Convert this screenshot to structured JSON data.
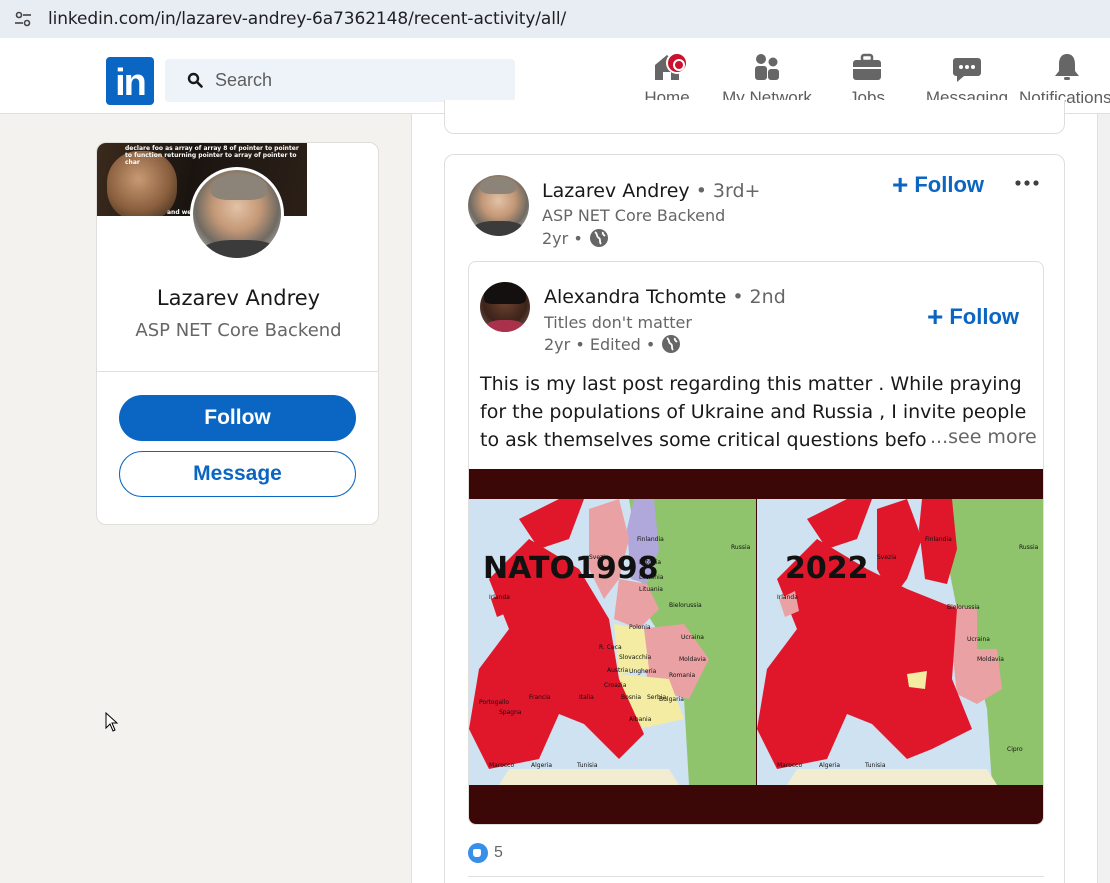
{
  "browser": {
    "url": "linkedin.com/in/lazarev-andrey-6a7362148/recent-activity/all/"
  },
  "header": {
    "logo_text": "in",
    "search_placeholder": "Search",
    "nav": [
      {
        "label": "Home",
        "icon": "home-icon",
        "notification_badge": true
      },
      {
        "label": "My Network",
        "icon": "people-icon"
      },
      {
        "label": "Jobs",
        "icon": "briefcase-icon"
      },
      {
        "label": "Messaging",
        "icon": "chat-icon"
      },
      {
        "label": "Notifications",
        "icon": "bell-icon"
      }
    ]
  },
  "profile_card": {
    "name": "Lazarev Andrey",
    "headline": "ASP NET Core Backend",
    "cover_meme_text": "declare foo as array of array 8 of pointer to pointer to function returning pointer to array of pointer to char",
    "cover_meme_text_2": "and we p",
    "follow_label": "Follow",
    "message_label": "Message"
  },
  "post": {
    "author": "Lazarev Andrey",
    "degree": "• 3rd+",
    "headline": "ASP NET Core Backend",
    "time": "2yr •",
    "follow_label": "Follow",
    "shared": {
      "author": "Alexandra Tchomte",
      "degree": "• 2nd",
      "headline": "Titles don't matter",
      "time": "2yr • Edited •",
      "follow_label": "Follow",
      "text": "This is my last post regarding this matter . While praying for the populations of Ukraine and Russia , I invite people to ask themselves some critical questions before conclud",
      "see_more": "...see more",
      "image": {
        "left_title": "NATO1998",
        "right_title": "2022",
        "labels_left": [
          "Finlandia",
          "Russia",
          "Svezia",
          "Estonia",
          "Lettonia",
          "Lituania",
          "Bielorussia",
          "Irlanda",
          "Polonia",
          "Ucraina",
          "R. Ceca",
          "Slovacchia",
          "Moldavia",
          "Austria",
          "Ungheria",
          "Romania",
          "Croazia",
          "Bosnia",
          "Serbia",
          "Bulgaria",
          "Portogallo",
          "Spagna",
          "Francia",
          "Italia",
          "Albania",
          "Marocco",
          "Algeria",
          "Tunisia"
        ],
        "labels_right": [
          "Finlandia",
          "Russia",
          "Svezia",
          "Bielorussia",
          "Irlanda",
          "Ucraina",
          "Moldavia",
          "Marocco",
          "Algeria",
          "Tunisia",
          "Cipro"
        ],
        "colors": {
          "nato": "#e0162b",
          "sea": "#cfe2f1",
          "russia": "#8fc46c",
          "frame": "#3c0707"
        }
      }
    },
    "reaction_count": "5"
  },
  "colors": {
    "linkedin_blue": "#0a66c2",
    "badge_red": "#cb112d",
    "page_bg": "#f4f2ee"
  }
}
